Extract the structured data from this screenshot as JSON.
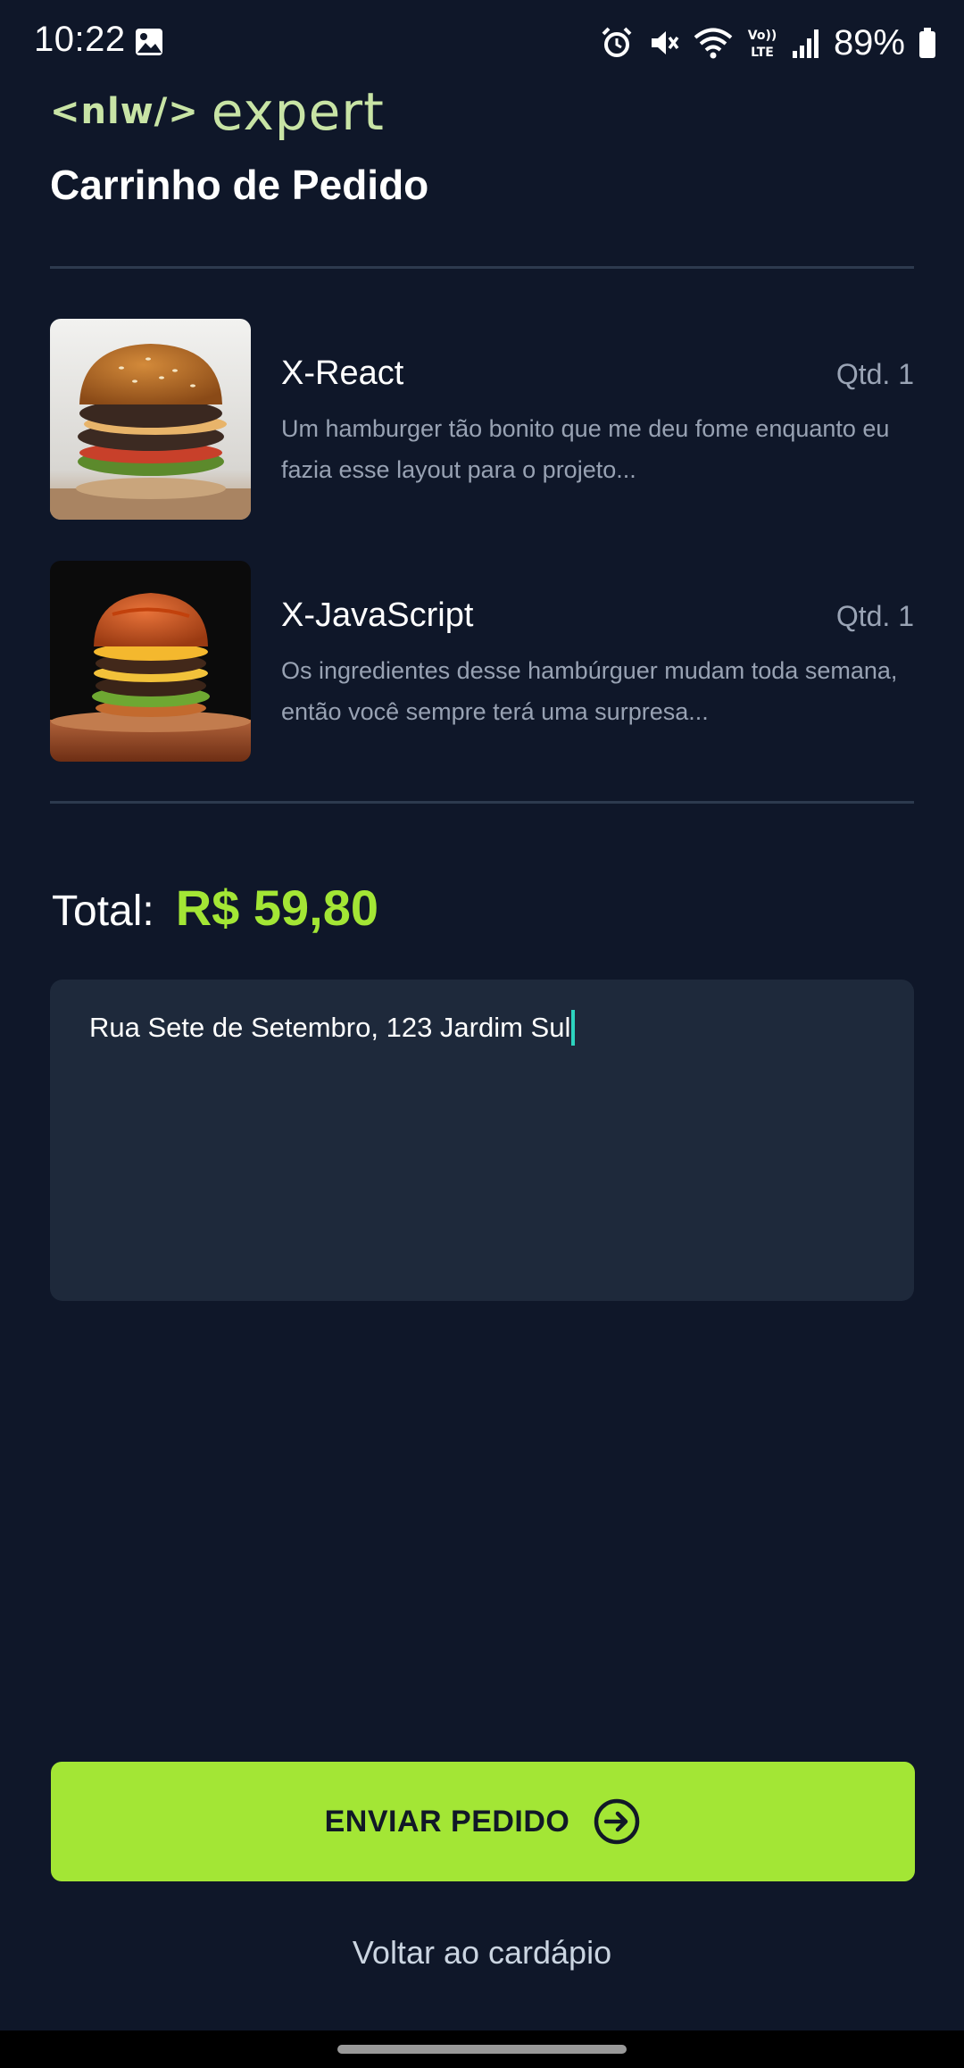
{
  "status_bar": {
    "time": "10:22",
    "battery": "89%",
    "icons": [
      "image-icon",
      "alarm-icon",
      "mute-icon",
      "wifi-icon",
      "volte-icon",
      "signal-icon",
      "battery-icon"
    ],
    "volte_top": "Vo))",
    "volte_bottom": "LTE"
  },
  "header": {
    "logo_left": "<nlw/>",
    "logo_right": "expert",
    "title": "Carrinho de Pedido"
  },
  "cart": {
    "items": [
      {
        "name": "X-React",
        "qty": "Qtd. 1",
        "description": "Um hamburger tão bonito que me deu fome enquanto eu fazia esse layout para o projeto..."
      },
      {
        "name": "X-JavaScript",
        "qty": "Qtd. 1",
        "description": "Os ingredientes desse hambúrguer mudam toda semana, então você sempre terá uma surpresa..."
      }
    ]
  },
  "summary": {
    "total_label": "Total:",
    "total_value": "R$ 59,80"
  },
  "address": {
    "value": "Rua Sete de Setembro, 123 Jardim Sul"
  },
  "actions": {
    "send_label": "ENVIAR PEDIDO",
    "back_label": "Voltar ao cardápio"
  },
  "colors": {
    "background": "#0f1729",
    "accent": "#a3e635",
    "input_bg": "#1e293b",
    "caret": "#2dd4bf"
  }
}
